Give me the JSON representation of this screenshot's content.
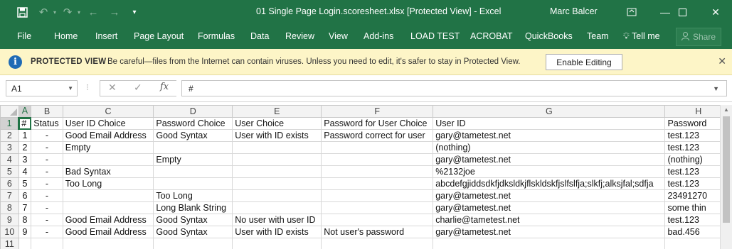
{
  "titlebar": {
    "title": "01 Single Page Login.scoresheet.xlsx  [Protected View] - Excel",
    "user": "Marc Balcer",
    "icons": {
      "save": "save-icon",
      "undo": "undo-icon",
      "redo": "redo-icon",
      "back": "back-icon",
      "forward": "forward-icon",
      "customize": "customize-qat-icon",
      "ribbon_display": "ribbon-display-options-icon",
      "minimize": "minimize-icon",
      "maximize": "maximize-icon",
      "close": "close-icon"
    }
  },
  "ribbon": {
    "tabs": [
      "File",
      "Home",
      "Insert",
      "Page Layout",
      "Formulas",
      "Data",
      "Review",
      "View",
      "Add-ins",
      "LOAD TEST",
      "ACROBAT",
      "QuickBooks",
      "Team"
    ],
    "tell_me": "Tell me",
    "share": "Share"
  },
  "protected_view": {
    "title": "PROTECTED VIEW",
    "message": "Be careful—files from the Internet can contain viruses. Unless you need to edit, it's safer to stay in Protected View.",
    "enable_button": "Enable Editing"
  },
  "formula_bar": {
    "name_box": "A1",
    "formula": "#"
  },
  "sheet": {
    "columns": [
      "A",
      "B",
      "C",
      "D",
      "E",
      "F",
      "G",
      "H"
    ],
    "row_numbers": [
      "1",
      "2",
      "3",
      "4",
      "5",
      "6",
      "7",
      "8",
      "9",
      "10",
      "11"
    ],
    "rows": [
      [
        "#",
        "Status",
        "User ID Choice",
        "Password Choice",
        "User Choice",
        "Password for User Choice",
        "User ID",
        "Password"
      ],
      [
        "1",
        "-",
        "Good Email Address",
        "Good Syntax",
        "User with ID exists",
        "Password correct for user",
        "gary@tametest.net",
        "test.123"
      ],
      [
        "2",
        "-",
        "Empty",
        "",
        "",
        "",
        "(nothing)",
        "test.123"
      ],
      [
        "3",
        "-",
        "",
        "Empty",
        "",
        "",
        "gary@tametest.net",
        "(nothing)"
      ],
      [
        "4",
        "-",
        "Bad Syntax",
        "",
        "",
        "",
        "%2132joe",
        "test.123"
      ],
      [
        "5",
        "-",
        "Too Long",
        "",
        "",
        "",
        "abcdefgjiddsdkfjdksldkjflskldskfjslfslfja;slkfj;alksjfal;sdfja",
        "test.123"
      ],
      [
        "6",
        "-",
        "",
        "Too Long",
        "",
        "",
        "gary@tametest.net",
        "23491270"
      ],
      [
        "7",
        "-",
        "",
        "Long Blank String",
        "",
        "",
        "gary@tametest.net",
        "some thin"
      ],
      [
        "8",
        "-",
        "Good Email Address",
        "Good Syntax",
        "No user with user ID",
        "",
        "charlie@tametest.net",
        "test.123"
      ],
      [
        "9",
        "-",
        "Good Email Address",
        "Good Syntax",
        "User with ID exists",
        "Not user's password",
        "gary@tametest.net",
        "bad.456"
      ],
      [
        "",
        "",
        "",
        "",
        "",
        "",
        "",
        ""
      ]
    ]
  },
  "colors": {
    "excel_green": "#217346",
    "protected_bar": "#fdf5c7",
    "header_bg": "#f3f3f3"
  }
}
